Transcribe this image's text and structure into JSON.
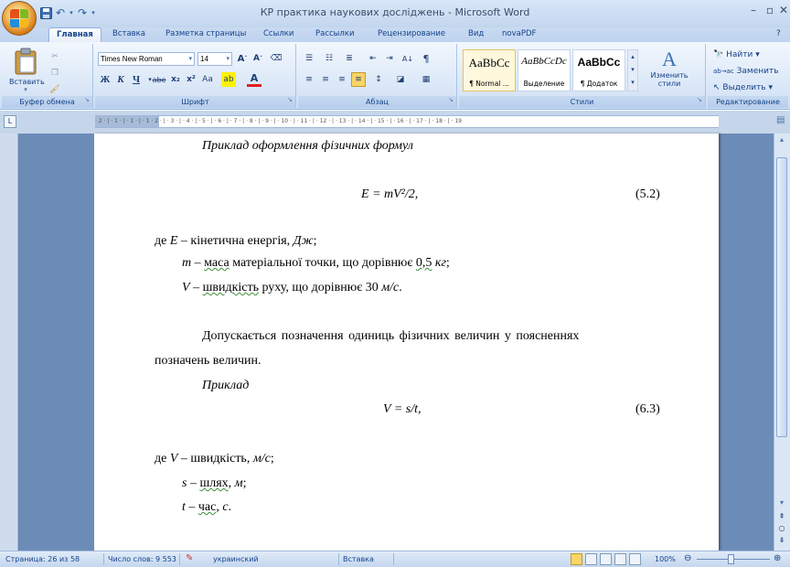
{
  "app": {
    "title": "КР практика наукових досліджень - Microsoft Word",
    "window_buttons": {
      "minimize": "–",
      "maximize": "▫",
      "close": "✕"
    },
    "help": "?"
  },
  "tabs": [
    "Главная",
    "Вставка",
    "Разметка страницы",
    "Ссылки",
    "Рассылки",
    "Рецензирование",
    "Вид",
    "novaPDF"
  ],
  "ribbon": {
    "clipboard": {
      "paste_label": "Вставить",
      "group_label": "Буфер обмена"
    },
    "font": {
      "font_name": "Times New Roman",
      "font_size": "14",
      "group_label": "Шрифт",
      "bold": "Ж",
      "italic": "К",
      "underline": "Ч",
      "strike": "abe",
      "subscript": "x₂",
      "superscript": "x²",
      "change_case": "Aa",
      "highlight": "ab",
      "font_color": "A"
    },
    "paragraph": {
      "group_label": "Абзац"
    },
    "styles": {
      "group_label": "Стили",
      "items": [
        {
          "sample": "AaBbCc",
          "name": "¶ Normal ..."
        },
        {
          "sample": "AaBbCcDc",
          "name": "Выделение"
        },
        {
          "sample": "AaBbCc",
          "name": "¶ Додаток"
        }
      ],
      "change_styles": "Изменить стили"
    },
    "editing": {
      "group_label": "Редактирование",
      "find": "Найти",
      "replace": "Заменить",
      "select": "Выделить"
    }
  },
  "ruler": {
    "text": "· 2 · | · 1 · | · 1 · | · 1 · 2 · | · 3 · | · 4 · | · 5 · | · 6 · | · 7 · | · 8 · | · 9 · | · 10 · | · 11 · | · 12 · | · 13 · | · 14 · | · 15 · | · 16 · | · 17 · | · 18 · | · 19"
  },
  "document": {
    "example_heading": "Приклад оформлення фізичних формул",
    "formula1": {
      "lhs": "E",
      "rhs": " = mV²/2,",
      "number": "(5.2)"
    },
    "where1": {
      "lead": "де ",
      "var": "E",
      "text": " – кінетична енергія, ",
      "unit": "Дж",
      "end": ";"
    },
    "line_m": {
      "var": "m",
      "dash": " – ",
      "word": "маса",
      "text": " матеріальної точки, що дорівнює ",
      "value": "0,5",
      "space": " ",
      "unit": "кг",
      "end": ";"
    },
    "line_V": {
      "var": "V",
      "dash": " – ",
      "word": "швидкість",
      "text": " руху, що дорівнює 30 ",
      "unit": "м/с",
      "end": "."
    },
    "para_line1": "Допускається  позначення  одиниць  фізичних  величин    у  поясненнях",
    "para_line2": "позначень величин.",
    "example2": "Приклад",
    "formula2": {
      "lhs": "V",
      "rhs": " = s/t,",
      "number": "(6.3)"
    },
    "where2": {
      "lead": "де ",
      "var": "V",
      "text": " – швидкість, ",
      "unit": "м/с",
      "end": ";"
    },
    "line_s": {
      "var": "s",
      "dash": " – ",
      "word": "шлях",
      "text": ", ",
      "unit": "м",
      "end": ";"
    },
    "line_t": {
      "var": "t",
      "dash": " – ",
      "word": "час",
      "text": ", ",
      "unit": "с",
      "end": "."
    }
  },
  "status": {
    "page": "Страница: 26 из 58",
    "words": "Число слов: 9 553",
    "language": "украинский",
    "mode": "Вставка",
    "zoom": "100%"
  },
  "colors": {
    "accent": "#15428b",
    "ribbon": "#dde9f8",
    "workspace": "#6c8cb8"
  }
}
